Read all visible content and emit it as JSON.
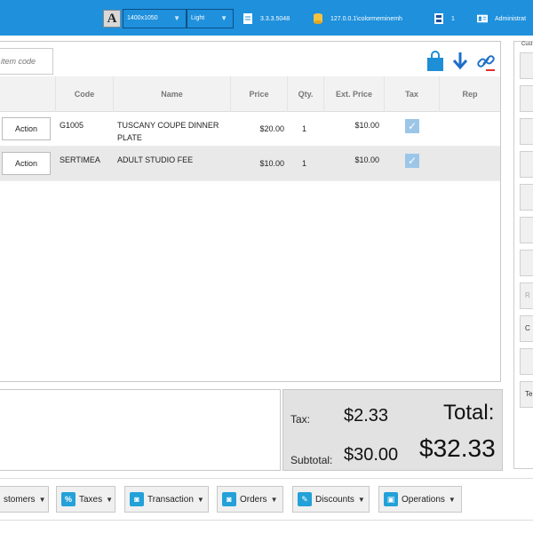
{
  "topbar": {
    "font_icon_letter": "A",
    "resolution": "1400x1050",
    "theme": "Light",
    "version": "3.3.3.5048",
    "server": "127.0.0.1\\colormeminemh",
    "register": "1",
    "user": "Administrat"
  },
  "search": {
    "placeholder": "item code"
  },
  "grid": {
    "columns": [
      "Code",
      "Name",
      "Price",
      "Qty.",
      "Ext. Price",
      "Tax",
      "Rep"
    ],
    "rows": [
      {
        "action": "Action",
        "code": "G1005",
        "name": "TUSCANY COUPE DINNER PLATE",
        "price": "$20.00",
        "qty": "1",
        "ext": "$10.00",
        "tax": true
      },
      {
        "action": "Action",
        "code": "SERTIMEA",
        "name": "ADULT STUDIO FEE",
        "price": "$10.00",
        "qty": "1",
        "ext": "$10.00",
        "tax": true
      }
    ]
  },
  "totals": {
    "tax_label": "Tax:",
    "tax": "$2.33",
    "total_label": "Total:",
    "total": "$32.33",
    "subtotal_label": "Subtotal:",
    "subtotal": "$30.00"
  },
  "right_panel": {
    "label": "Cust",
    "buttons": [
      "",
      "",
      "",
      "",
      "",
      "",
      "",
      "",
      "R",
      "C",
      "",
      "Te"
    ]
  },
  "bottom_bar": [
    {
      "label": "stomers",
      "icon": "customers-icon",
      "glyph": ""
    },
    {
      "label": "Taxes",
      "icon": "percent-icon",
      "glyph": "%"
    },
    {
      "label": "Transaction",
      "icon": "bag-icon",
      "glyph": "◙"
    },
    {
      "label": "Orders",
      "icon": "bag-icon",
      "glyph": "◙"
    },
    {
      "label": "Discounts",
      "icon": "tag-icon",
      "glyph": "✎"
    },
    {
      "label": "Operations",
      "icon": "register-icon",
      "glyph": "▣"
    }
  ],
  "colors": {
    "topbar": "#1e90dc",
    "accent": "#23a1d8",
    "check": "#9cc6e8"
  }
}
